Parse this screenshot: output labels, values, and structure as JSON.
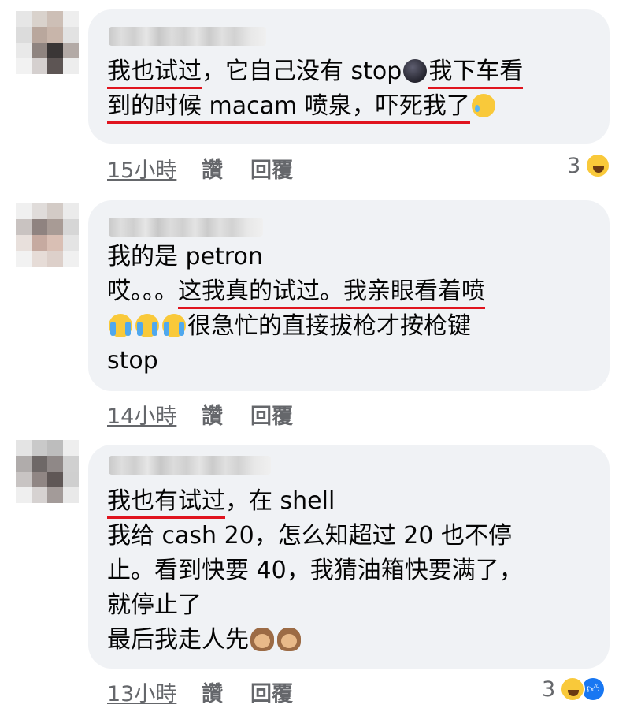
{
  "comments": [
    {
      "lines": [
        [
          {
            "t": "我也试过",
            "u": true
          },
          {
            "t": "，它自己没有 stop"
          },
          {
            "emoji": "new-moon-face"
          },
          {
            "t": "我下车看",
            "u": true
          }
        ],
        [
          {
            "t": "到的时候 macam 喷泉，吓死我了",
            "u": true
          },
          {
            "emoji": "sad-tear-face"
          }
        ]
      ],
      "time": "15小時",
      "like": "讚",
      "reply": "回覆",
      "reaction_count": "3",
      "reaction_icons": [
        "laughing-face-icon"
      ]
    },
    {
      "lines": [
        [
          {
            "t": "我的是 petron"
          }
        ],
        [
          {
            "t": "哎。。。"
          },
          {
            "t": "这我真的试过。我亲眼看着喷",
            "u": true
          }
        ],
        [
          {
            "emoji": "crying-face"
          },
          {
            "emoji": "crying-face"
          },
          {
            "emoji": "crying-face"
          },
          {
            "t": "很急忙的直接拔枪才按枪键"
          }
        ],
        [
          {
            "t": "stop"
          }
        ]
      ],
      "time": "14小時",
      "like": "讚",
      "reply": "回覆"
    },
    {
      "lines": [
        [
          {
            "t": "我也有试过",
            "u": true
          },
          {
            "t": "，在 shell"
          }
        ],
        [
          {
            "t": "我给 cash 20，怎么知超过 20 也不停"
          }
        ],
        [
          {
            "t": "止。看到快要 40，我猜油箱快要满了，"
          }
        ],
        [
          {
            "t": "就停止了"
          }
        ],
        [
          {
            "t": "最后我走人先"
          },
          {
            "emoji": "see-no-evil-monkey"
          },
          {
            "emoji": "see-no-evil-monkey"
          }
        ]
      ],
      "time": "13小時",
      "like": "讚",
      "reply": "回覆",
      "reaction_count": "3",
      "reaction_icons": [
        "laughing-face-icon",
        "thumbs-up-icon"
      ]
    }
  ],
  "colors": {
    "bubble": "#f0f2f5",
    "underline": "#e0141e",
    "meta": "#65676b",
    "like_blue": "#1877f2"
  }
}
